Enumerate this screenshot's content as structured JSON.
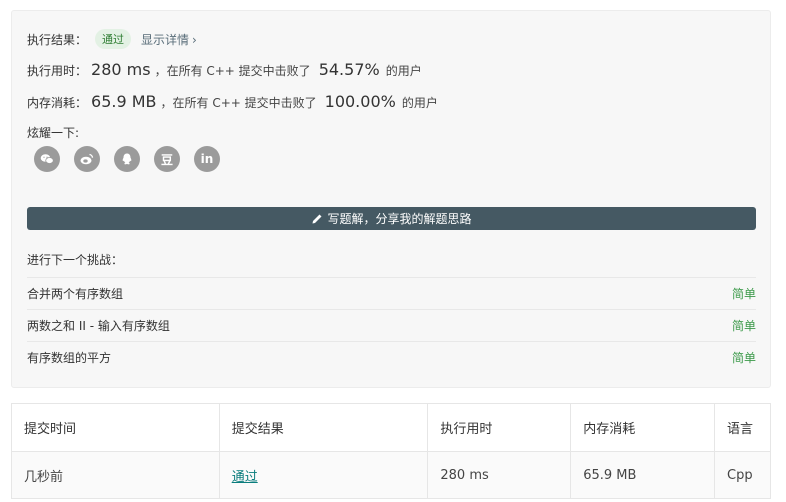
{
  "result": {
    "status_label": "执行结果：",
    "status_badge": "通过",
    "detail_link": "显示详情",
    "runtime": {
      "label": "执行用时：",
      "value": "280 ms",
      "mid_text": "，在所有 C++ 提交中击败了",
      "percent": "54.57%",
      "suffix": "的用户"
    },
    "memory": {
      "label": "内存消耗：",
      "value": "65.9 MB",
      "mid_text": "，在所有 C++ 提交中击败了",
      "percent": "100.00%",
      "suffix": "的用户"
    },
    "share_label": "炫耀一下:",
    "share_buttons": [
      "wechat-icon",
      "weibo-icon",
      "qq-icon",
      "douban-icon",
      "linkedin-icon"
    ],
    "douban_text": "豆",
    "linkedin_text": "in",
    "write_button": "写题解，分享我的解题思路"
  },
  "next": {
    "title": "进行下一个挑战：",
    "problems": [
      {
        "name": "合并两个有序数组",
        "difficulty": "简单"
      },
      {
        "name": "两数之和 II - 输入有序数组",
        "difficulty": "简单"
      },
      {
        "name": "有序数组的平方",
        "difficulty": "简单"
      }
    ]
  },
  "submissions": {
    "headers": [
      "提交时间",
      "提交结果",
      "执行用时",
      "内存消耗",
      "语言"
    ],
    "rows": [
      {
        "time": "几秒前",
        "result": "通过",
        "runtime": "280 ms",
        "memory": "65.9 MB",
        "language": "Cpp"
      }
    ]
  },
  "colors": {
    "badge_bg": "#e3f1e4",
    "badge_text": "#2e7d32",
    "write_button_bg": "#455963",
    "difficulty_easy": "#3c9a4a",
    "link_teal": "#0a7d7d",
    "share_icon_bg": "#9b9b9b"
  }
}
